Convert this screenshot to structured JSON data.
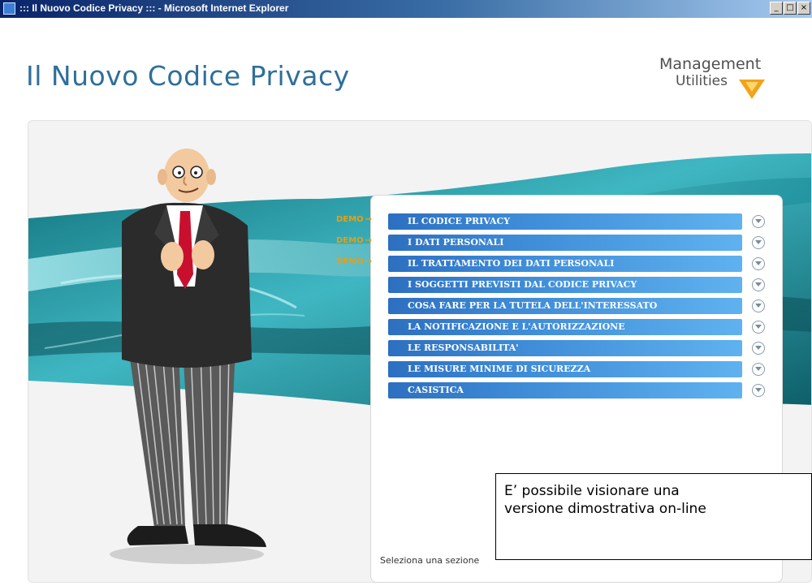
{
  "window": {
    "title": "::: Il Nuovo Codice Privacy ::: - Microsoft Internet Explorer",
    "minimize_label": "_",
    "maximize_label": "□",
    "close_label": "×"
  },
  "header": {
    "title": "Il Nuovo Codice Privacy",
    "logo_line1": "Management",
    "logo_line2": "Utilities"
  },
  "menu": {
    "items": [
      {
        "label": "IL CODICE PRIVACY",
        "demo": "DEMO"
      },
      {
        "label": "I DATI PERSONALI",
        "demo": "DEMO"
      },
      {
        "label": "IL TRATTAMENTO DEI DATI PERSONALI",
        "demo": "DEMO"
      },
      {
        "label": "I SOGGETTI PREVISTI DAL CODICE PRIVACY"
      },
      {
        "label": "COSA FARE PER LA TUTELA DELL'INTERESSATO"
      },
      {
        "label": "LA NOTIFICAZIONE E L'AUTORIZZAZIONE"
      },
      {
        "label": "LE RESPONSABILITA'"
      },
      {
        "label": "LE MISURE MINIME DI SICUREZZA"
      },
      {
        "label": "CASISTICA"
      }
    ],
    "arrow": "→"
  },
  "footer": {
    "status": "Seleziona una sezione"
  },
  "callout": {
    "line1": "E’ possibile visionare una",
    "line2": "versione dimostrativa on-line"
  },
  "colors": {
    "title_blue": "#2f6f9a",
    "menu_blue": "#3d8ad6",
    "demo_orange": "#e3a018",
    "logo_orange": "#f2a21b",
    "teal_swoosh": "#1f8f9c"
  },
  "icons": [
    "window-app-icon",
    "logo-chevron-icon",
    "chevron-down-icon"
  ]
}
